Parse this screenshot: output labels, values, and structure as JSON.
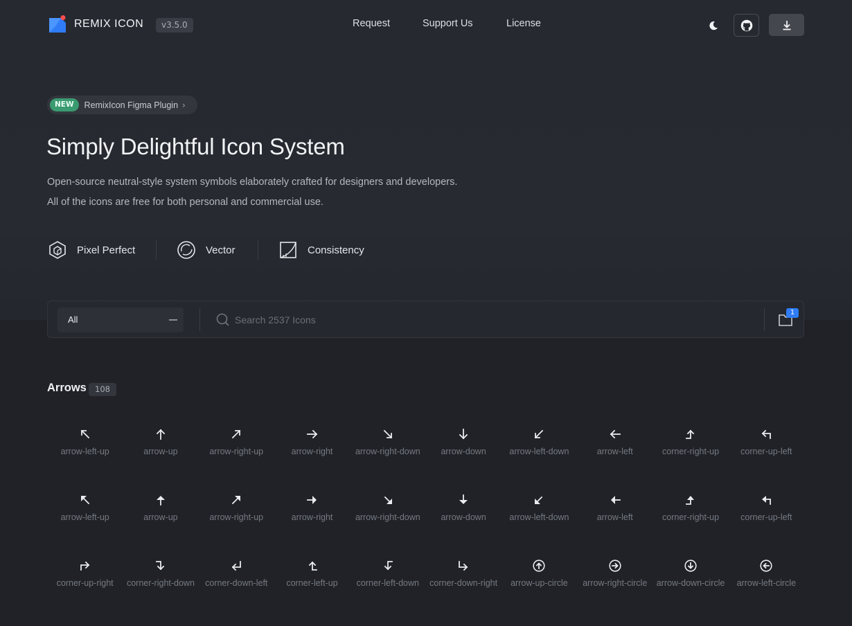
{
  "header": {
    "brand": "REMIX ICON",
    "version": "v3.5.0",
    "nav": [
      "Request",
      "Support Us",
      "License"
    ],
    "icons": [
      "moon-icon",
      "github-icon",
      "download-icon"
    ],
    "accent": "#3b82f6"
  },
  "promo": {
    "badge": "NEW",
    "text": "RemixIcon Figma Plugin",
    "chevron": "›",
    "badge_color": "#3a9a70"
  },
  "hero": {
    "title": "Simply Delightful Icon System",
    "subtitle_line1": "Open-source neutral-style system symbols elaborately crafted for designers and developers.",
    "subtitle_line2": "All of the icons are free for both personal and commercial use."
  },
  "features": [
    {
      "label": "Pixel Perfect",
      "icon": "cube-icon"
    },
    {
      "label": "Vector",
      "icon": "vector-circle-icon"
    },
    {
      "label": "Consistency",
      "icon": "square-curve-icon"
    }
  ],
  "search": {
    "category": "All",
    "placeholder": "Search 2537 Icons",
    "collection_count": "1"
  },
  "section": {
    "title": "Arrows",
    "count": "108"
  },
  "icons": [
    {
      "name": "arrow-left-up",
      "glyph": "line-left-up"
    },
    {
      "name": "arrow-up",
      "glyph": "line-up"
    },
    {
      "name": "arrow-right-up",
      "glyph": "line-right-up"
    },
    {
      "name": "arrow-right",
      "glyph": "line-right"
    },
    {
      "name": "arrow-right-down",
      "glyph": "line-right-down"
    },
    {
      "name": "arrow-down",
      "glyph": "line-down"
    },
    {
      "name": "arrow-left-down",
      "glyph": "line-left-down"
    },
    {
      "name": "arrow-left",
      "glyph": "line-left"
    },
    {
      "name": "corner-right-up",
      "glyph": "corner-right-up"
    },
    {
      "name": "corner-up-left",
      "glyph": "corner-up-left"
    },
    {
      "name": "arrow-left-up",
      "glyph": "fill-left-up"
    },
    {
      "name": "arrow-up",
      "glyph": "fill-up"
    },
    {
      "name": "arrow-right-up",
      "glyph": "fill-right-up"
    },
    {
      "name": "arrow-right",
      "glyph": "fill-right"
    },
    {
      "name": "arrow-right-down",
      "glyph": "fill-right-down"
    },
    {
      "name": "arrow-down",
      "glyph": "fill-down"
    },
    {
      "name": "arrow-left-down",
      "glyph": "fill-left-down"
    },
    {
      "name": "arrow-left",
      "glyph": "fill-left"
    },
    {
      "name": "corner-right-up",
      "glyph": "fill-corner-right-up"
    },
    {
      "name": "corner-up-left",
      "glyph": "fill-corner-up-left"
    },
    {
      "name": "corner-up-right",
      "glyph": "corner-up-right"
    },
    {
      "name": "corner-right-down",
      "glyph": "corner-right-down"
    },
    {
      "name": "corner-down-left",
      "glyph": "corner-down-left"
    },
    {
      "name": "corner-left-up",
      "glyph": "corner-left-up"
    },
    {
      "name": "corner-left-down",
      "glyph": "corner-left-down"
    },
    {
      "name": "corner-down-right",
      "glyph": "corner-down-right"
    },
    {
      "name": "arrow-up-circle",
      "glyph": "circle-up"
    },
    {
      "name": "arrow-right-circle",
      "glyph": "circle-right"
    },
    {
      "name": "arrow-down-circle",
      "glyph": "circle-down"
    },
    {
      "name": "arrow-left-circle",
      "glyph": "circle-left"
    }
  ]
}
